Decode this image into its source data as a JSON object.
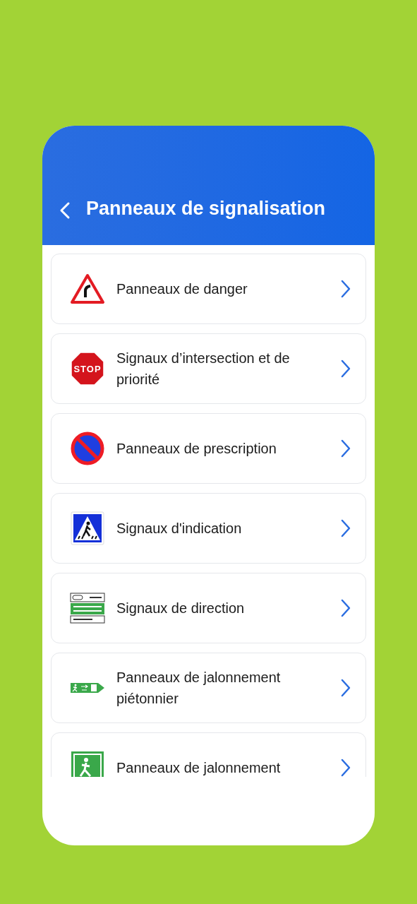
{
  "header": {
    "title": "Panneaux de signalisation"
  },
  "items": [
    {
      "label": "Panneaux de danger",
      "kind": "danger"
    },
    {
      "label": "Signaux d’intersection et de priorité",
      "kind": "stop",
      "sign_text": "STOP"
    },
    {
      "label": "Panneaux de prescription",
      "kind": "prescription"
    },
    {
      "label": "Signaux d'indication",
      "kind": "indication"
    },
    {
      "label": "Signaux de direction",
      "kind": "direction"
    },
    {
      "label": "Panneaux de jalonnement piétonnier",
      "kind": "pedestrian"
    },
    {
      "label": "Panneaux de jalonnement",
      "kind": "facility"
    }
  ]
}
